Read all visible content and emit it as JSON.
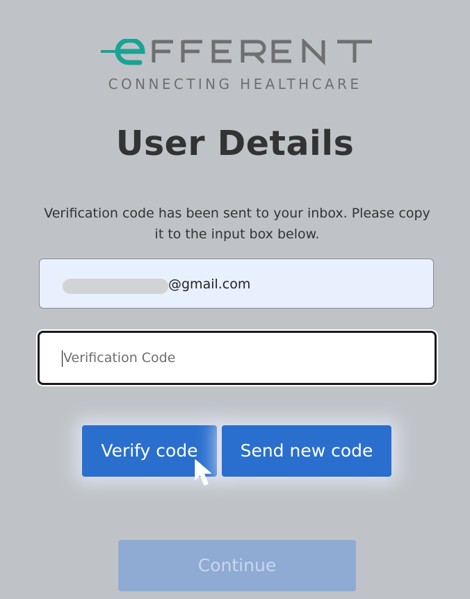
{
  "brand": {
    "logo_text": "EFFERENT",
    "tagline": "CONNECTING HEALTHCARE",
    "colors": {
      "accent": "#1aa394",
      "text_gray": "#6f6f6f"
    }
  },
  "page": {
    "title": "User Details",
    "info": "Verification code has been sent to your inbox. Please copy it to the input box below."
  },
  "form": {
    "email_visible_suffix": "@gmail.com",
    "code_placeholder": "Verification Code",
    "code_value": ""
  },
  "buttons": {
    "verify": "Verify code",
    "resend": "Send new code",
    "continue": "Continue"
  },
  "colors": {
    "background": "#bfc3c7",
    "primary": "#2a6fce",
    "disabled": "#8fabd4",
    "input_fill": "#e8effd"
  },
  "icons": {
    "cursor": "mouse-pointer-icon"
  }
}
